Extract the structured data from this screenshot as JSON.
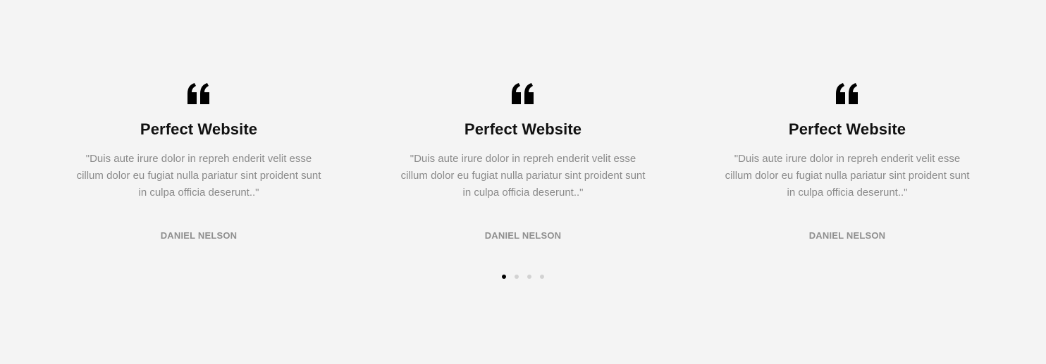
{
  "testimonials": [
    {
      "icon": "quote-icon",
      "title": "Perfect Website",
      "text": "\"Duis aute irure dolor in repreh enderit velit esse cillum dolor eu fugiat nulla pariatur sint proident sunt in culpa officia deserunt..\"",
      "author": "DANIEL NELSON"
    },
    {
      "icon": "quote-icon",
      "title": "Perfect Website",
      "text": "\"Duis aute irure dolor in repreh enderit velit esse cillum dolor eu fugiat nulla pariatur sint proident sunt in culpa officia deserunt..\"",
      "author": "DANIEL NELSON"
    },
    {
      "icon": "quote-icon",
      "title": "Perfect Website",
      "text": "\"Duis aute irure dolor in repreh enderit velit esse cillum dolor eu fugiat nulla pariatur sint proident sunt in culpa officia deserunt..\"",
      "author": "DANIEL NELSON"
    }
  ],
  "pagination": {
    "count": 4,
    "active_index": 0
  },
  "colors": {
    "background": "#f4f4f4",
    "title": "#111111",
    "body_text": "#8a8a8a",
    "author": "#8f8f8f",
    "dot_active": "#000000",
    "dot_inactive": "#d2d2d2"
  }
}
